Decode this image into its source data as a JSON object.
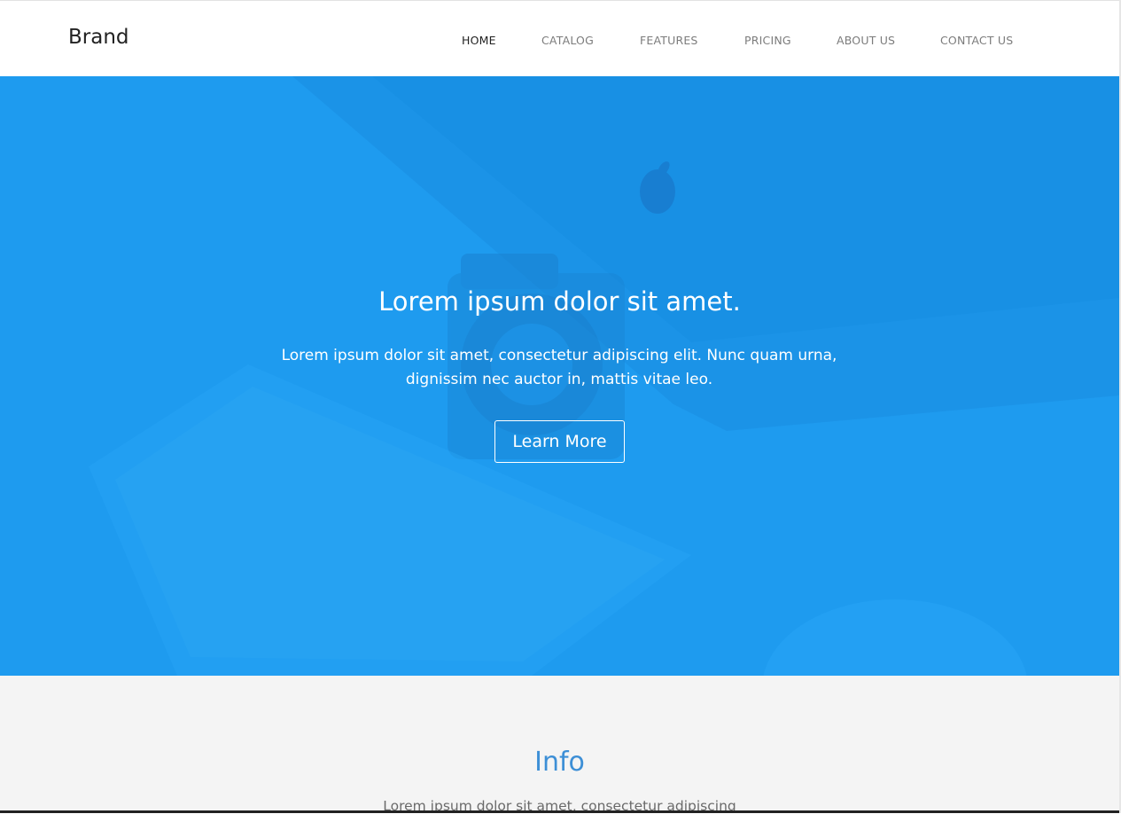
{
  "navbar": {
    "brand": "Brand",
    "items": [
      {
        "label": "HOME",
        "active": true
      },
      {
        "label": "CATALOG",
        "active": false
      },
      {
        "label": "FEATURES",
        "active": false
      },
      {
        "label": "PRICING",
        "active": false
      },
      {
        "label": "ABOUT US",
        "active": false
      },
      {
        "label": "CONTACT US",
        "active": false
      }
    ]
  },
  "hero": {
    "title": "Lorem ipsum dolor sit amet.",
    "text": "Lorem ipsum dolor sit amet, consectetur adipiscing elit. Nunc quam urna, dignissim nec auctor in, mattis vitae leo.",
    "button_label": "Learn More",
    "overlay_color": "#1e9bef"
  },
  "info": {
    "title": "Info",
    "text": "Lorem ipsum dolor sit amet, consectetur adipiscing",
    "title_color": "#3d8fd6"
  }
}
